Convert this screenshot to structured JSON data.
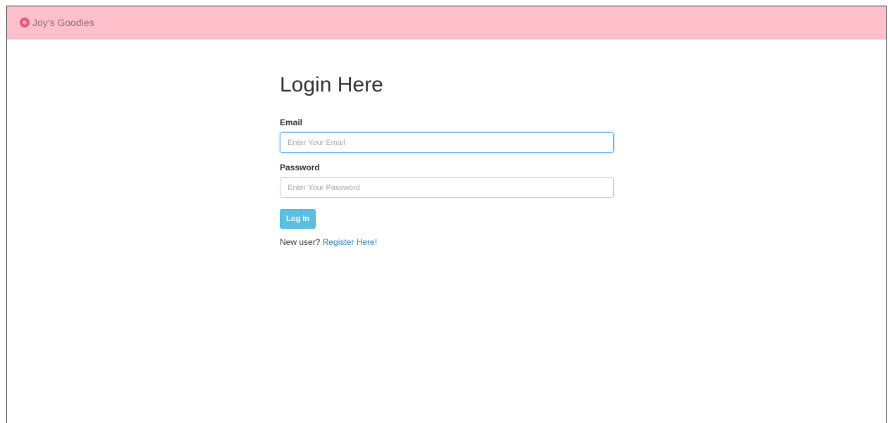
{
  "navbar": {
    "brand_label": "Joy's Goodies",
    "brand_icon": "logo-icon",
    "bg_color": "#ffc0cb"
  },
  "login": {
    "title": "Login Here",
    "email_label": "Email",
    "email_placeholder": "Enter Your Email",
    "email_value": "",
    "password_label": "Password",
    "password_placeholder": "Enter Your Password",
    "password_value": "",
    "submit_label": "Log In",
    "register_prompt": "New user?",
    "register_link": "Register Here!"
  },
  "colors": {
    "button": "#5bc0de",
    "link": "#337ab7",
    "focus_border": "#66afe9"
  }
}
